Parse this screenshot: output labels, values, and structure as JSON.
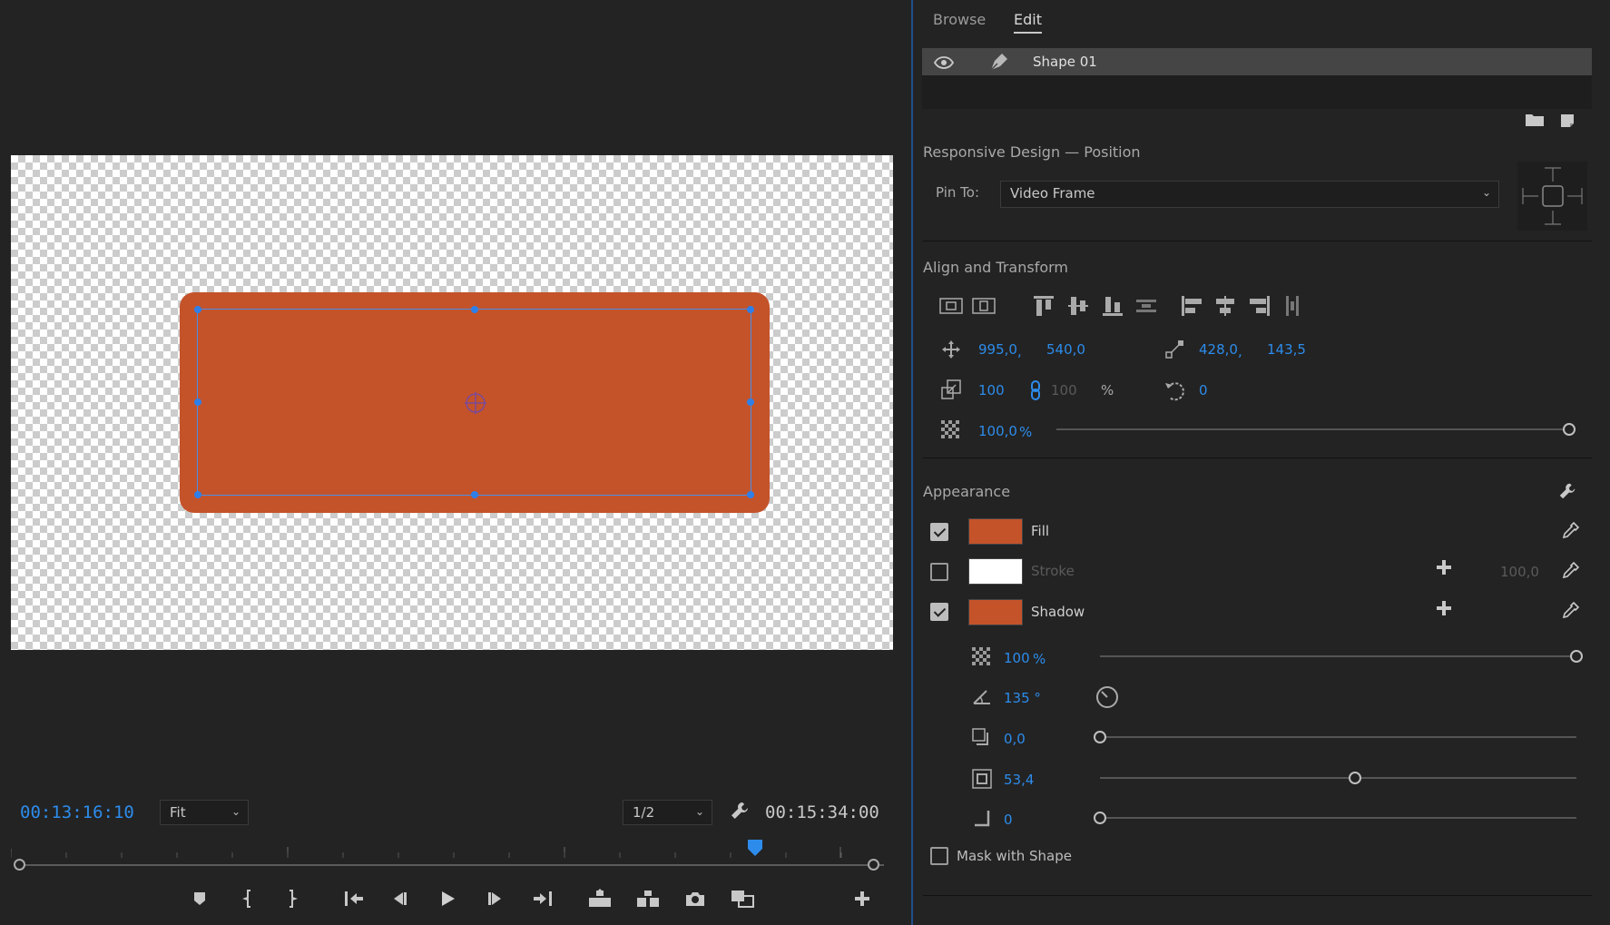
{
  "monitor": {
    "current_timecode": "00:13:16:10",
    "total_timecode": "00:15:34:00",
    "fit_value": "Fit",
    "resolution_value": "1/2",
    "shape_color": "#c4532a"
  },
  "panel": {
    "tabs": {
      "browse": "Browse",
      "edit": "Edit"
    },
    "layer": {
      "name": "Shape 01"
    },
    "responsive": {
      "title": "Responsive Design — Position",
      "pin_label": "Pin To:",
      "pin_value": "Video Frame"
    },
    "transform": {
      "title": "Align and Transform",
      "pos_x": "995,0",
      "pos_y": "540,0",
      "anchor_x": "428,0",
      "anchor_y": "143,5",
      "scale": "100",
      "scale_linked": "100",
      "scale_unit": "%",
      "rotation": "0",
      "opacity": "100,0",
      "opacity_unit": "%",
      "comma": ","
    },
    "appearance": {
      "title": "Appearance",
      "fill_label": "Fill",
      "fill_color": "#c4532a",
      "stroke_label": "Stroke",
      "stroke_color": "#ffffff",
      "stroke_width": "100,0",
      "shadow_label": "Shadow",
      "shadow_color": "#c4532a",
      "shadow_opacity": "100",
      "shadow_opacity_unit": "%",
      "shadow_angle": "135 °",
      "shadow_distance": "0,0",
      "shadow_size": "53,4",
      "shadow_blur": "0",
      "mask_label": "Mask with Shape",
      "fill_checked": true,
      "stroke_checked": false,
      "shadow_checked": true,
      "mask_checked": false
    }
  }
}
